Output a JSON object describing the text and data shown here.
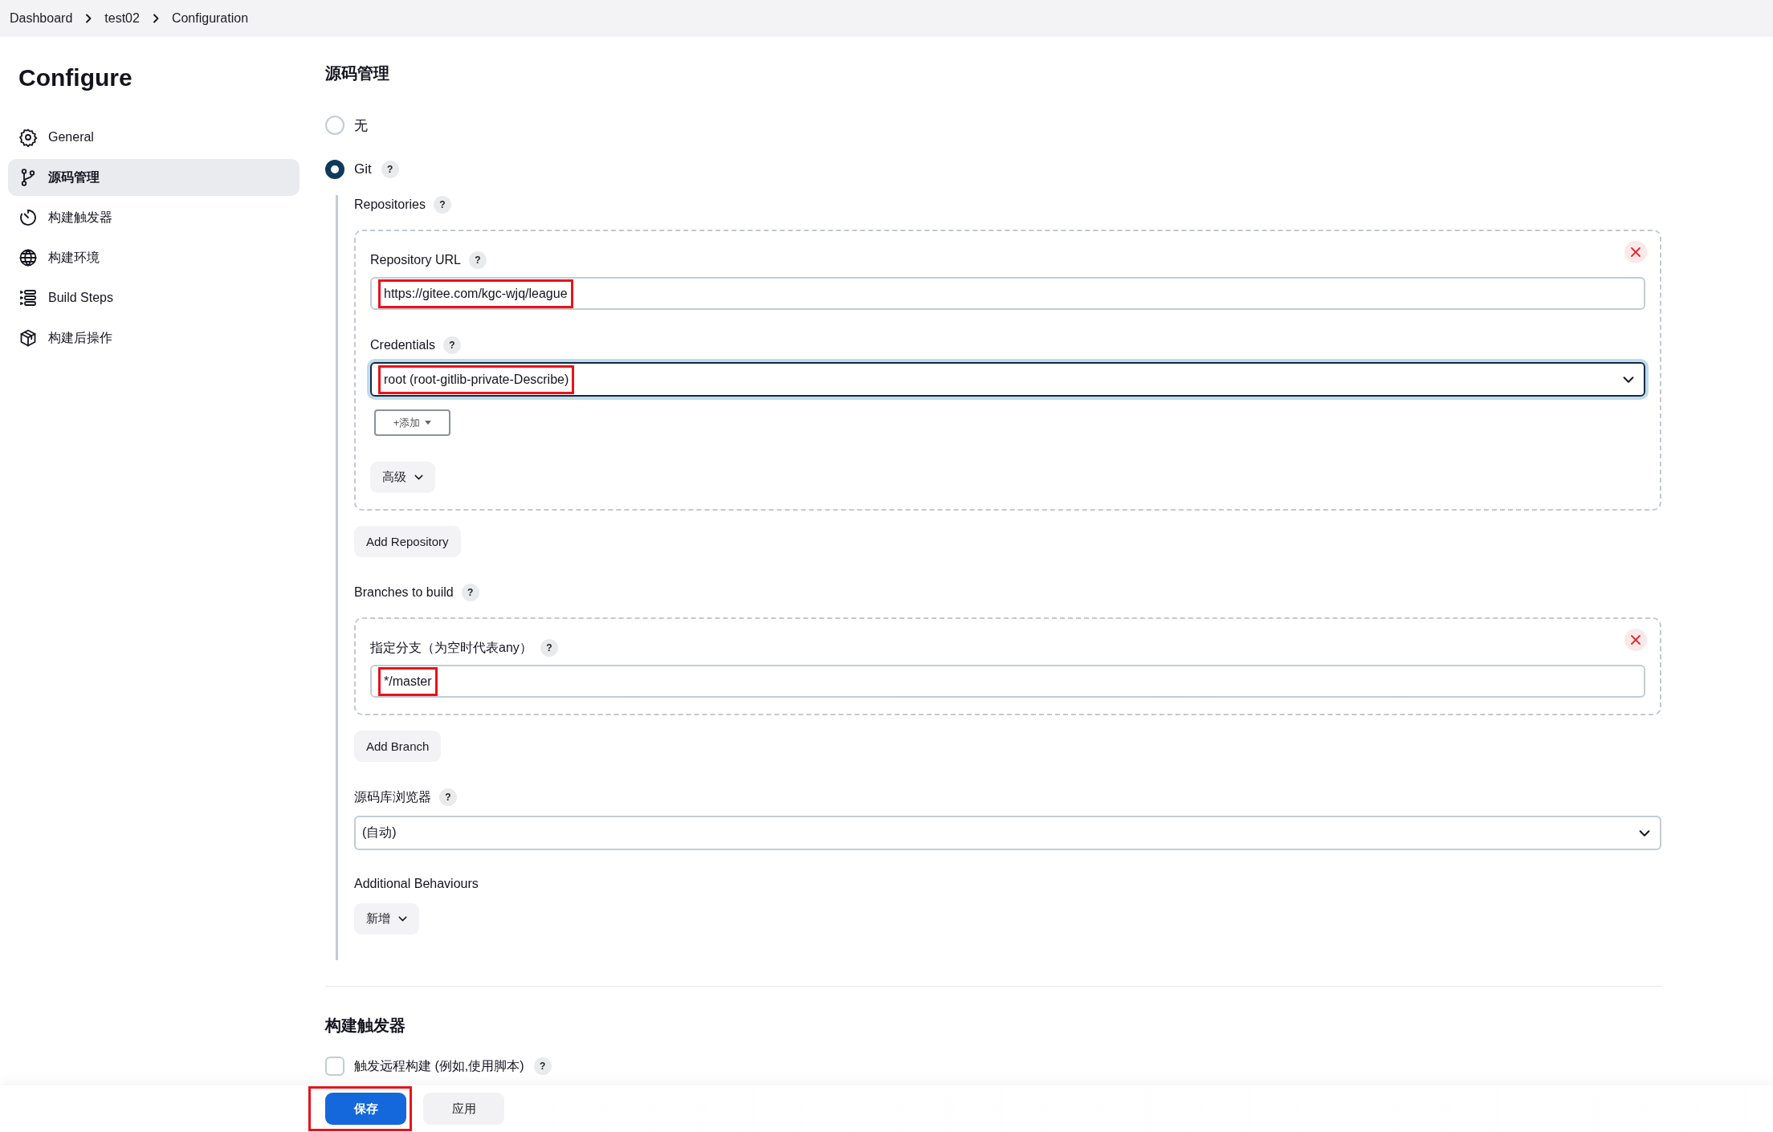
{
  "breadcrumbs": [
    {
      "label": "Dashboard"
    },
    {
      "label": "test02"
    },
    {
      "label": "Configuration"
    }
  ],
  "sidebar": {
    "title": "Configure",
    "items": [
      {
        "label": "General",
        "kind": "gear",
        "selected": false
      },
      {
        "label": "源码管理",
        "kind": "branch",
        "selected": true
      },
      {
        "label": "构建触发器",
        "kind": "timer",
        "selected": false
      },
      {
        "label": "构建环境",
        "kind": "globe",
        "selected": false
      },
      {
        "label": "Build Steps",
        "kind": "steps",
        "selected": false
      },
      {
        "label": "构建后操作",
        "kind": "package",
        "selected": false
      }
    ]
  },
  "scm": {
    "title": "源码管理",
    "options": [
      {
        "label": "无",
        "selected": false
      },
      {
        "label": "Git",
        "selected": true,
        "help": "?"
      }
    ],
    "git": {
      "repositories": {
        "label": "Repositories",
        "help": "?"
      },
      "repository": {
        "url_label": "Repository URL",
        "url_help": "?",
        "url": "https://gitee.com/kgc-wjq/league",
        "url_highlighted": true,
        "credentials_label": "Credentials",
        "credentials_help": "?",
        "credentials": "root (root-gitlib-private-Describe)",
        "credentials_highlighted": true,
        "credentials_focused": true,
        "add_button": "+添加",
        "advanced_button": "高级"
      },
      "add_repository": "Add Repository",
      "branches": {
        "label": "Branches to build",
        "help": "?"
      },
      "branch": {
        "label": "指定分支（为空时代表any）",
        "help": "?",
        "value": "*/master",
        "highlighted": true
      },
      "add_branch": "Add Branch",
      "browser": {
        "label": "源码库浏览器",
        "help": "?",
        "value": "(自动)"
      },
      "behaviours": {
        "label": "Additional Behaviours",
        "button": "新增"
      }
    }
  },
  "triggers": {
    "title": "构建触发器",
    "items": [
      {
        "label": "触发远程构建 (例如,使用脚本)",
        "help": "?",
        "checked": false
      }
    ]
  },
  "footer": {
    "buttons": [
      {
        "label": "保存",
        "kind": "primary",
        "highlighted": true
      },
      {
        "label": "应用",
        "kind": "secondary",
        "highlighted": false
      }
    ]
  }
}
